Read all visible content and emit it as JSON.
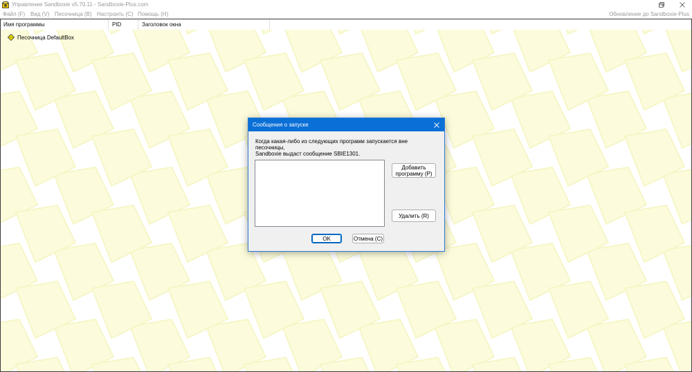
{
  "window": {
    "title": "Управление Sandboxie v5.70.11 - Sandboxie-Plus.com",
    "minimize_icon": "minimize-icon",
    "maximize_icon": "restore-icon",
    "close_icon": "close-icon"
  },
  "menu": {
    "items": [
      "Файл (F)",
      "Вид (V)",
      "Песочница (В)",
      "Настроить (С)",
      "Помощь (H)"
    ],
    "update_link": "Обновление до Sandboxie-Plus"
  },
  "list": {
    "columns": [
      "Имя программы",
      "PID",
      "Заголовок окна"
    ],
    "rows": [
      {
        "label": "Песочница DefaultBox",
        "icon": "sandbox-icon"
      }
    ]
  },
  "dialog": {
    "title": "Сообщения о запуске",
    "message_line1": "Когда какая-либо из следующих программ запускается вне песочницы,",
    "message_line2": "Sandboxie выдаст сообщение SBIE1301.",
    "add_button_line1": "Добавить",
    "add_button_line2": "программу (P)",
    "remove_button": "Удалить (R)",
    "ok_button": "OK",
    "cancel_button": "Отмена (C)",
    "accent_color": "#0a6fd6"
  },
  "colors": {
    "pattern_fill": "#fcfcdc",
    "pattern_stroke": "#f6f6c8",
    "disabled_text": "#9a9a9a"
  }
}
